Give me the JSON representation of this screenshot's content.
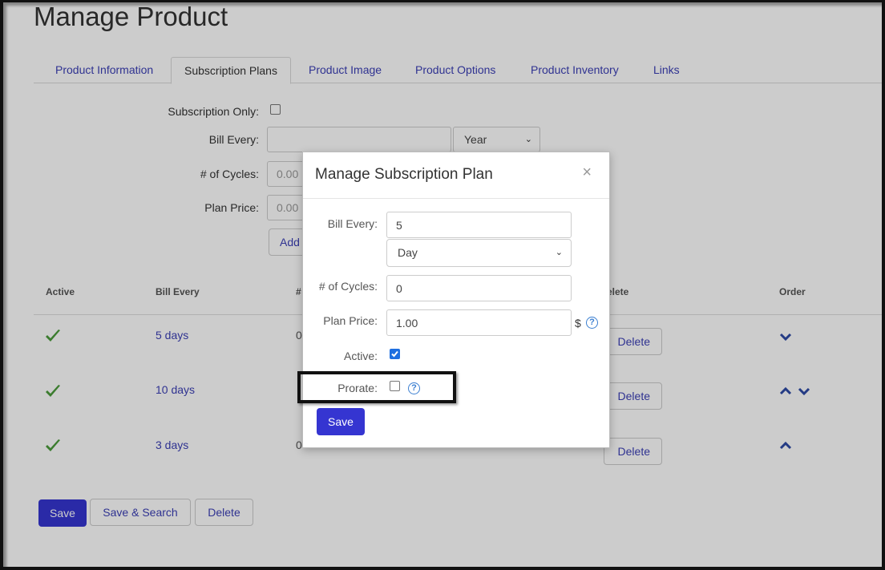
{
  "page": {
    "title": "Manage Product"
  },
  "tabs": [
    {
      "label": "Product Information"
    },
    {
      "label": "Subscription Plans"
    },
    {
      "label": "Product  Image"
    },
    {
      "label": "Product  Options"
    },
    {
      "label": "Product  Inventory"
    },
    {
      "label": "Links"
    }
  ],
  "form": {
    "subscription_only_label": "Subscription Only:",
    "bill_every_label": "Bill Every:",
    "bill_every_unit": "Year",
    "cycles_label": "# of Cycles:",
    "cycles_placeholder": "0.00",
    "plan_price_label": "Plan Price:",
    "plan_price_placeholder": "0.00",
    "add_button_label": "Add"
  },
  "table": {
    "headers": {
      "active": "Active",
      "bill_every": "Bill Every",
      "cycles": "#",
      "delete": "elete",
      "order": "Order"
    },
    "rows": [
      {
        "active": true,
        "bill_every": "5 days",
        "cycles": "0",
        "delete_label": "Delete"
      },
      {
        "active": true,
        "bill_every": "10 days",
        "cycles": "",
        "delete_label": "Delete"
      },
      {
        "active": true,
        "bill_every": "3 days",
        "cycles": "0",
        "delete_label": "Delete"
      }
    ]
  },
  "footer": {
    "save_label": "Save",
    "save_search_label": "Save & Search",
    "delete_label": "Delete"
  },
  "modal": {
    "title": "Manage Subscription Plan",
    "close_glyph": "×",
    "bill_every_label": "Bill Every:",
    "bill_every_value": "5",
    "bill_every_unit": "Day",
    "cycles_label": "# of Cycles:",
    "cycles_value": "0",
    "plan_price_label": "Plan Price:",
    "plan_price_value": "1.00",
    "currency": "$",
    "active_label": "Active:",
    "prorate_label": "Prorate:",
    "help_glyph": "?",
    "save_label": "Save"
  },
  "colors": {
    "accent": "#3535d1",
    "link": "#3b3fb6",
    "check_green": "#4a9b3a"
  }
}
